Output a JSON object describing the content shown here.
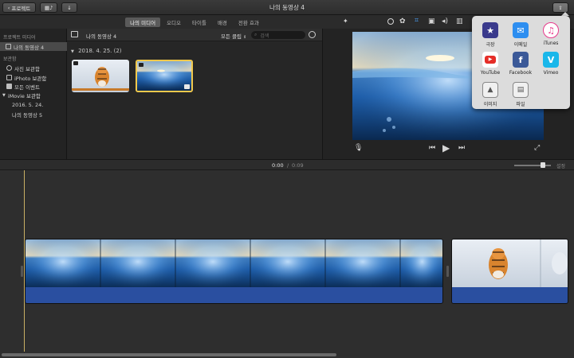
{
  "titlebar": {
    "projects_button": "프로젝트",
    "window_title": "나의 동영상 4"
  },
  "browser_tabs": [
    {
      "label": "나의 미디어",
      "active": true
    },
    {
      "label": "오디오",
      "active": false
    },
    {
      "label": "타이틀",
      "active": false
    },
    {
      "label": "배경",
      "active": false
    },
    {
      "label": "전환 효과",
      "active": false
    }
  ],
  "sidebar": {
    "section_project": "프로젝트 미디어",
    "project_item": "나의 동영상 4",
    "section_library": "보관함",
    "items": [
      {
        "label": "사진 보관함"
      },
      {
        "label": "iPhoto 보관함"
      },
      {
        "label": "모든 이벤트"
      },
      {
        "label": "iMovie 보관함"
      },
      {
        "label": "2016. 5. 24."
      },
      {
        "label": "나의 동영상 5"
      }
    ]
  },
  "browser": {
    "header_title": "나의 동영상 4",
    "filter": "모든 클립",
    "search_placeholder": "검색",
    "date_group": "2018. 4. 25.  (2)"
  },
  "timecode": {
    "current": "0:00",
    "separator": "/",
    "total": "0:09"
  },
  "settings_label": "설정",
  "share_popover": {
    "items": [
      {
        "label": "극장",
        "icon": "theater-star-icon",
        "color": "#3a3a8c"
      },
      {
        "label": "이메일",
        "icon": "mail-icon",
        "color": "#2d8ef0"
      },
      {
        "label": "iTunes",
        "icon": "itunes-icon",
        "color": "#e83a8c"
      },
      {
        "label": "YouTube",
        "icon": "youtube-icon",
        "color": "#e52d27"
      },
      {
        "label": "Facebook",
        "icon": "facebook-icon",
        "color": "#3b5998"
      },
      {
        "label": "Vimeo",
        "icon": "vimeo-icon",
        "color": "#1ab7ea"
      },
      {
        "label": "이미지",
        "icon": "image-icon",
        "color": "#f0f0f0"
      },
      {
        "label": "파일",
        "icon": "film-file-icon",
        "color": "#f0f0f0"
      }
    ]
  },
  "colors": {
    "accent_blue": "#2a4fa0",
    "playhead": "#c9b064",
    "selection": "#f2c94c"
  }
}
